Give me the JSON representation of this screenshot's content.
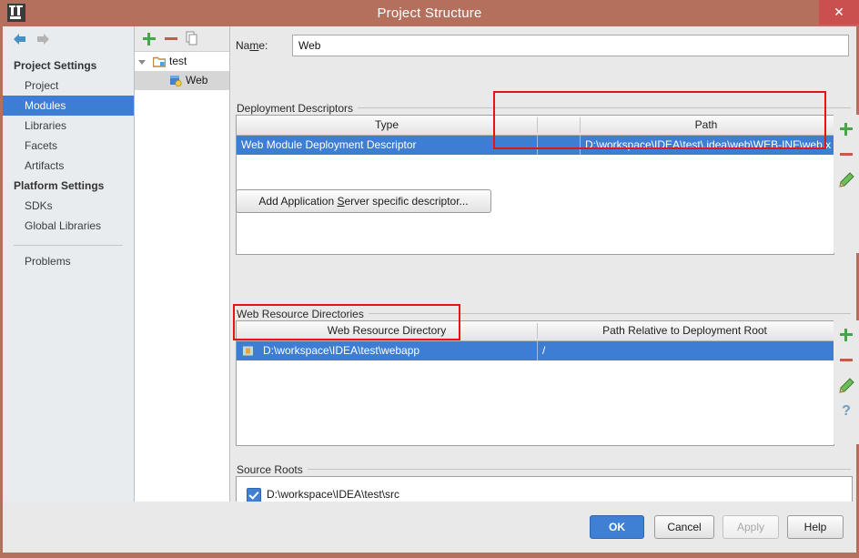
{
  "window": {
    "title": "Project Structure",
    "logo_icon": "intellij-idea-logo-icon",
    "close_label": "✕",
    "close_icon": "close-icon"
  },
  "nav": {
    "back_icon": "arrow-left-icon",
    "forward_icon": "arrow-right-icon",
    "groups": [
      {
        "label": "Project Settings",
        "items": [
          {
            "label": "Project",
            "selected": false
          },
          {
            "label": "Modules",
            "selected": true
          },
          {
            "label": "Libraries",
            "selected": false
          },
          {
            "label": "Facets",
            "selected": false
          },
          {
            "label": "Artifacts",
            "selected": false
          }
        ]
      },
      {
        "label": "Platform Settings",
        "items": [
          {
            "label": "SDKs",
            "selected": false
          },
          {
            "label": "Global Libraries",
            "selected": false
          }
        ]
      }
    ],
    "problems": {
      "label": "Problems"
    }
  },
  "tree": {
    "toolbar": {
      "add_icon": "plus-icon",
      "remove_icon": "minus-icon",
      "copy_icon": "copy-icon"
    },
    "nodes": [
      {
        "label": "test",
        "icon": "module-folder-icon",
        "expanded": true,
        "selected": false
      },
      {
        "label": "Web",
        "icon": "web-facet-icon",
        "expanded": false,
        "selected": true
      }
    ]
  },
  "main": {
    "name_field": {
      "label_pre": "Na",
      "label_mnemonic": "m",
      "label_post": "e:",
      "value": "Web"
    },
    "deployment_descriptors": {
      "section_title": "Deployment Descriptors",
      "columns": [
        "Type",
        "",
        "Path"
      ],
      "rows": [
        {
          "type": "Web Module Deployment Descriptor",
          "mid": "",
          "path": "D:\\workspace\\IDEA\\test\\.idea\\web\\WEB-INF\\web.xml",
          "selected": true
        }
      ],
      "actions": [
        {
          "icon": "plus-icon",
          "name": "add-descriptor-button"
        },
        {
          "icon": "minus-icon",
          "name": "remove-descriptor-button"
        },
        {
          "icon": "pencil-icon",
          "name": "edit-descriptor-button"
        }
      ]
    },
    "add_server_descriptor_button": {
      "label_pre": "Add Application ",
      "label_mnemonic": "S",
      "label_post": "erver specific descriptor..."
    },
    "web_resource_directories": {
      "section_title": "Web Resource Directories",
      "columns": [
        "Web Resource Directory",
        "Path Relative to Deployment Root"
      ],
      "rows": [
        {
          "directory": "D:\\workspace\\IDEA\\test\\webapp",
          "relative": "/",
          "icon": "folder-icon",
          "selected": true
        }
      ],
      "actions": [
        {
          "icon": "plus-icon",
          "name": "add-web-resource-button"
        },
        {
          "icon": "minus-icon",
          "name": "remove-web-resource-button"
        },
        {
          "icon": "pencil-icon",
          "name": "edit-web-resource-button"
        },
        {
          "icon": "question-mark-icon",
          "name": "help-web-resource-button"
        }
      ]
    },
    "source_roots": {
      "section_title": "Source Roots",
      "rows": [
        {
          "label": "D:\\workspace\\IDEA\\test\\src",
          "checked": true
        }
      ]
    }
  },
  "footer": {
    "ok": "OK",
    "cancel": "Cancel",
    "apply": "Apply",
    "help": "Help",
    "apply_disabled": true
  },
  "colors": {
    "title_bar": "#b4705c",
    "close_button": "#c9504f",
    "selection": "#3d7dd4",
    "accent_green": "#4aa24a",
    "accent_red": "#c05b4d",
    "annotation": "#e81313",
    "panel_bg": "#e9e9e9"
  },
  "annotations": {
    "highlight_rects": 2
  }
}
